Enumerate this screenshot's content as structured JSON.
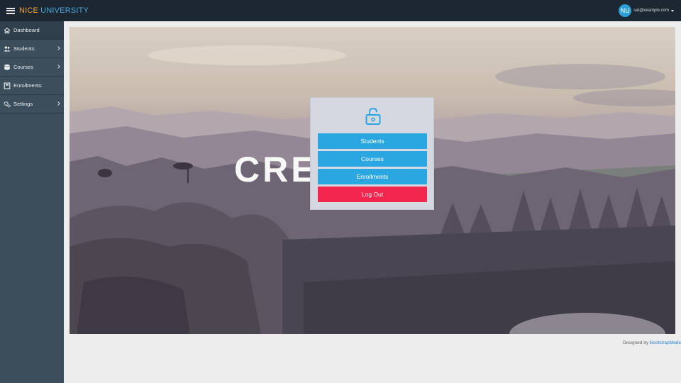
{
  "header": {
    "brand_part1": "NICE",
    "brand_part2": "UNIVERSITY",
    "avatar_initials": "NU",
    "user_email": "sat@example.com"
  },
  "sidebar": {
    "items": [
      {
        "label": "Dashboard",
        "icon": "home-icon",
        "active": true,
        "has_submenu": false
      },
      {
        "label": "Students",
        "icon": "users-icon",
        "active": false,
        "has_submenu": true
      },
      {
        "label": "Courses",
        "icon": "database-icon",
        "active": false,
        "has_submenu": true
      },
      {
        "label": "Enrollments",
        "icon": "address-book-icon",
        "active": false,
        "has_submenu": false
      },
      {
        "label": "Settings",
        "icon": "cogs-icon",
        "active": false,
        "has_submenu": true
      }
    ]
  },
  "banner": {
    "text": "CREATIVE"
  },
  "panel": {
    "icon": "unlock-icon",
    "buttons": [
      {
        "label": "Students",
        "color": "#2aa6e0"
      },
      {
        "label": "Courses",
        "color": "#2aa6e0"
      },
      {
        "label": "Enrollments",
        "color": "#2aa6e0"
      },
      {
        "label": "Log Out",
        "color": "#f2264e"
      }
    ]
  },
  "footer": {
    "designed_by": "Designed by",
    "link_text": "BootstrapMade"
  }
}
